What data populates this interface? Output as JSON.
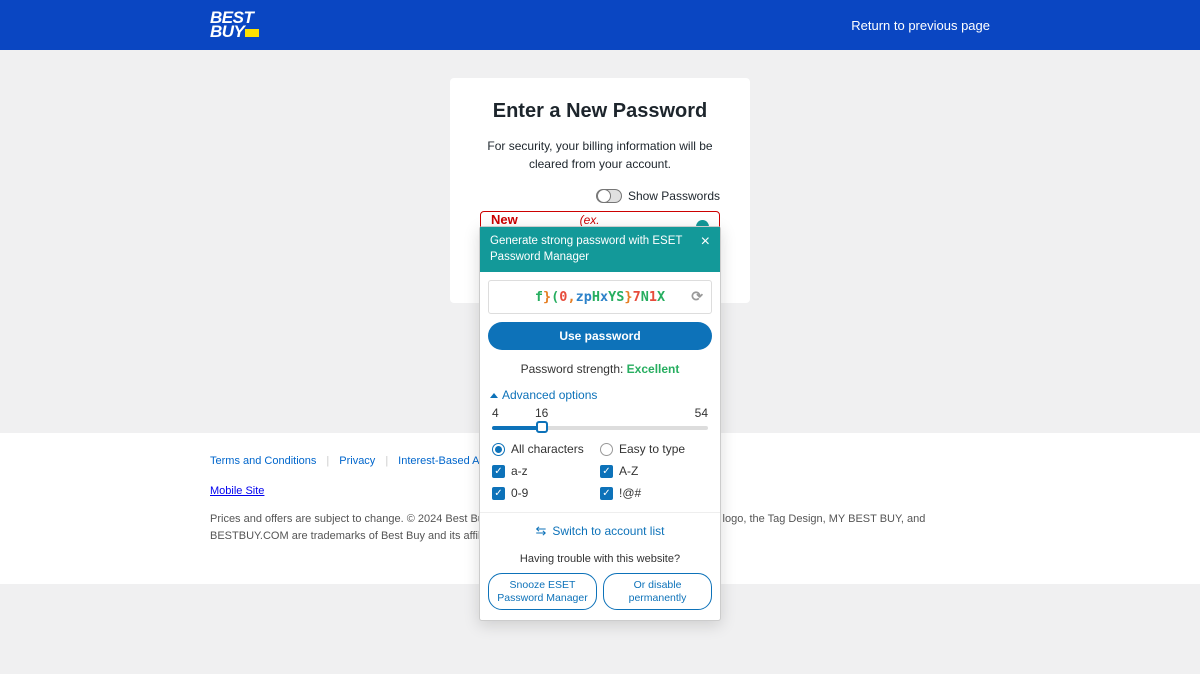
{
  "header": {
    "logo_line1": "BEST",
    "logo_line2": "BUY",
    "return_link": "Return to previous page"
  },
  "card": {
    "title": "Enter a New Password",
    "subtitle": "For security, your billing information will be cleared from your account.",
    "toggle_label": "Show Passwords",
    "pw_label": "New Password",
    "pw_hint": "(ex. \"Nine+twelve=21\")"
  },
  "popup": {
    "title": "Generate strong password with ESET Password Manager",
    "generated_chars": [
      "f",
      "}",
      "(",
      "0",
      ",",
      "z",
      "p",
      "H",
      "x",
      "Y",
      "S",
      "}",
      "7",
      "N",
      "1",
      "X"
    ],
    "use_btn": "Use password",
    "strength_label": "Password strength: ",
    "strength_value": "Excellent",
    "advanced_label": "Advanced options",
    "slider_min": "4",
    "slider_cur": "16",
    "slider_max": "54",
    "opt_all": "All characters",
    "opt_easy": "Easy to type",
    "opt_az": "a-z",
    "opt_AZ": "A-Z",
    "opt_09": "0-9",
    "opt_sym": "!@#",
    "switch_label": "Switch to account list",
    "trouble": "Having trouble with this website?",
    "snooze": "Snooze ESET Password Manager",
    "disable": "Or disable permanently"
  },
  "footer": {
    "terms": "Terms and Conditions",
    "privacy": "Privacy",
    "ads": "Interest-Based Ads",
    "mobile": "Mobile Site",
    "legal": "Prices and offers are subject to change. © 2024 Best Buy. All rights reserved. BEST BUY, the BEST BUY logo, the Tag Design, MY BEST BUY, and BESTBUY.COM are trademarks of Best Buy and its affiliated companies."
  }
}
